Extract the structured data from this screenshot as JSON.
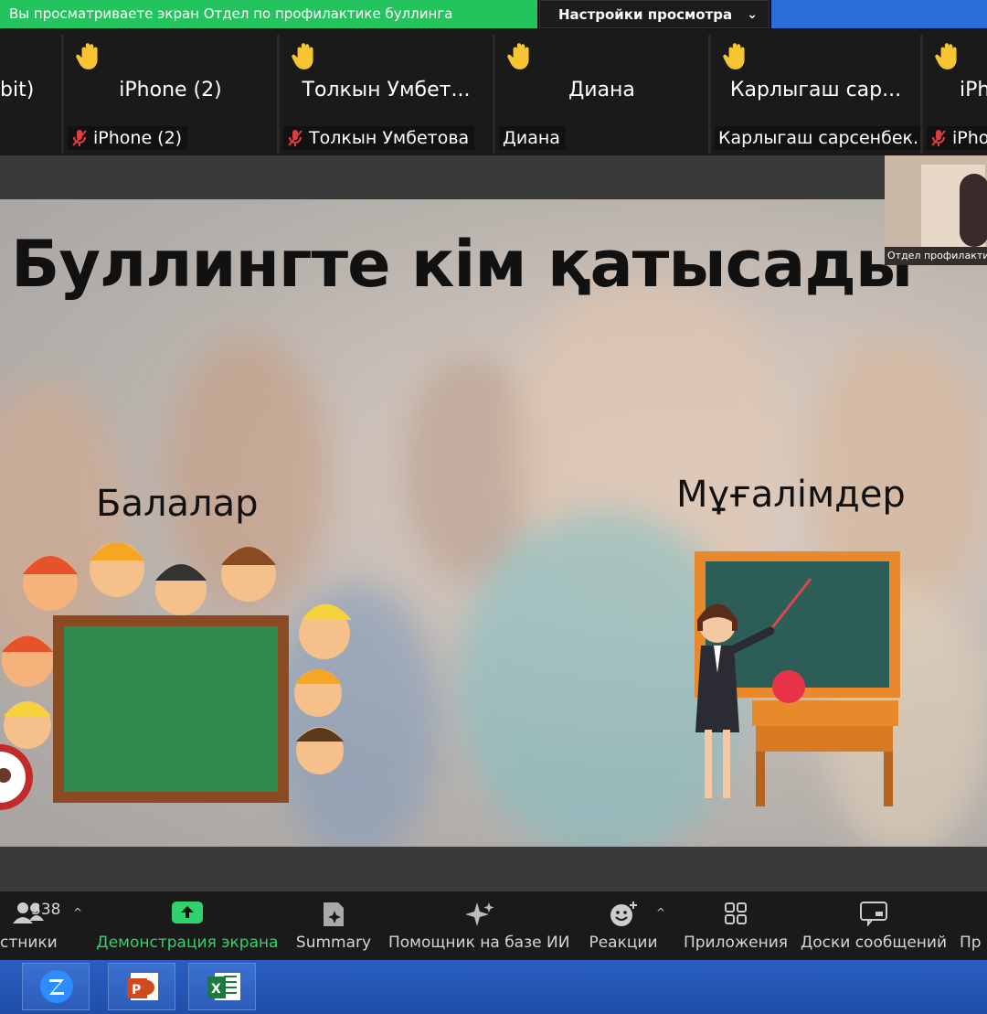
{
  "share_bar": {
    "viewing_text": "Вы просматриваете экран Отдел по профилактике буллинга",
    "view_options_label": "Настройки просмотра"
  },
  "participants": [
    {
      "display": "bit)",
      "caption": ""
    },
    {
      "display": "iPhone (2)",
      "caption": "iPhone (2)",
      "muted": true
    },
    {
      "display": "Толкын  Умбет...",
      "caption": "Толкын Умбетова",
      "muted": true
    },
    {
      "display": "Диана",
      "caption": "Диана",
      "muted": false
    },
    {
      "display": "Карлыгаш  сар...",
      "caption": "Карлыгаш сарсенбек...",
      "muted": false
    },
    {
      "display": "iPh",
      "caption": "iPho",
      "muted": true
    }
  ],
  "self_view": {
    "caption": "Отдел профилактики"
  },
  "slide": {
    "title": "Буллингте кім қатысады",
    "label_children": "Балалар",
    "label_teachers": "Мұғалімдер"
  },
  "toolbar": {
    "participants_count": "338",
    "participants_label": "стники",
    "share_label": "Демонстрация экрана",
    "summary_label": "Summary",
    "ai_label": "Помощник на базе ИИ",
    "reactions_label": "Реакции",
    "apps_label": "Приложения",
    "boards_label": "Доски сообщений",
    "more_label": "Пр"
  },
  "colors": {
    "share_green": "#23c45e",
    "toolbar_active": "#2fd36b",
    "taskbar_blue": "#2458be"
  }
}
